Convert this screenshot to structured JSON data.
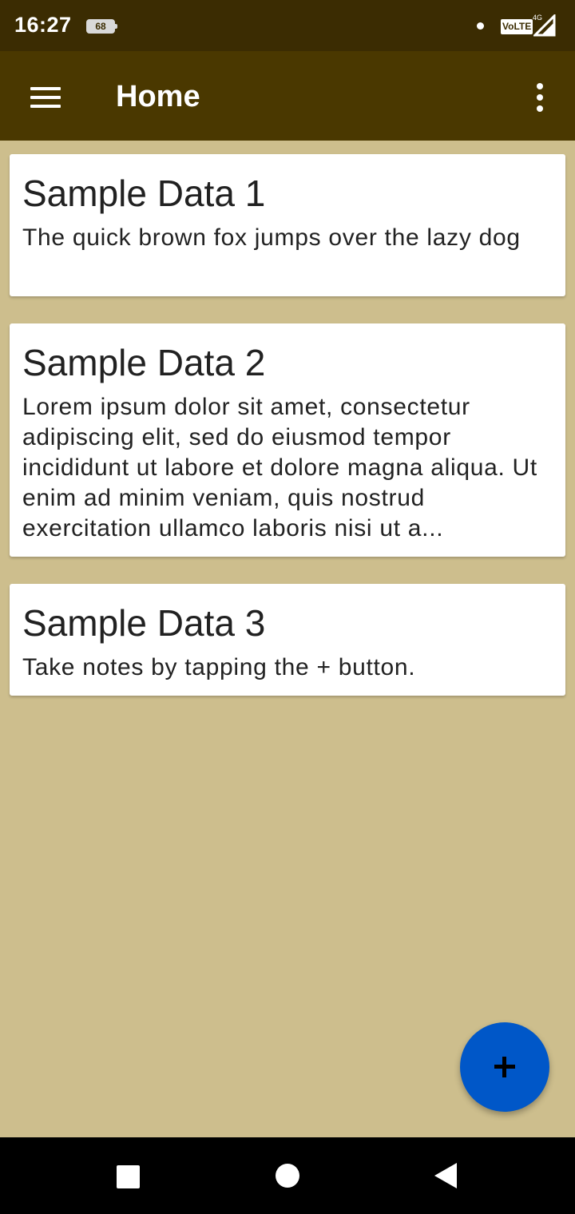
{
  "status_bar": {
    "time": "16:27",
    "battery_level": "68",
    "network_badge": "VoLTE",
    "network_type": "4G"
  },
  "app_bar": {
    "title": "Home",
    "menu_icon": "hamburger-menu-icon",
    "overflow_icon": "more-vert-icon"
  },
  "notes": [
    {
      "title": "Sample Data 1",
      "body": "The quick brown fox jumps over the lazy dog"
    },
    {
      "title": "Sample Data 2",
      "body": "Lorem ipsum dolor sit amet, consectetur adipiscing elit, sed do eiusmod tempor incididunt ut labore et dolore magna aliqua. Ut enim ad minim veniam, quis nostrud exercitation ullamco laboris nisi ut a..."
    },
    {
      "title": "Sample Data 3",
      "body": "Take notes by tapping the + button."
    }
  ],
  "fab": {
    "icon": "plus-icon"
  },
  "colors": {
    "background": "#cdbe8d",
    "app_bar": "#4a3800",
    "status_bar": "#3b2c02",
    "fab": "#0057c8",
    "card": "#ffffff"
  },
  "nav_bar": {
    "recents_icon": "square-recents-icon",
    "home_icon": "circle-home-icon",
    "back_icon": "triangle-back-icon"
  }
}
